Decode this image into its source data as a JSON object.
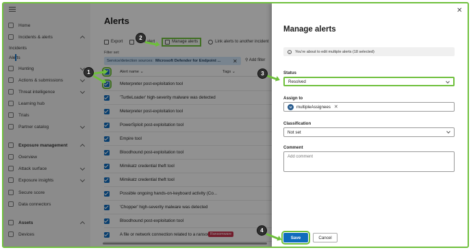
{
  "nav": {
    "items": [
      {
        "label": "Home",
        "icon": "home-icon",
        "chevron": ""
      },
      {
        "label": "Incidents & alerts",
        "icon": "shield-icon",
        "chevron": "up"
      },
      {
        "label": "Incidents",
        "sub": true
      },
      {
        "label": "Alerts",
        "sub": true,
        "active": true
      },
      {
        "label": "Hunting",
        "icon": "hunting-icon",
        "chevron": "down"
      },
      {
        "label": "Actions & submissions",
        "icon": "actions-icon",
        "chevron": "down"
      },
      {
        "label": "Threat intelligence",
        "icon": "intel-icon",
        "chevron": "down"
      },
      {
        "label": "Learning hub",
        "icon": "learning-icon",
        "chevron": ""
      },
      {
        "label": "Trials",
        "icon": "trials-icon",
        "chevron": ""
      },
      {
        "label": "Partner catalog",
        "icon": "catalog-icon",
        "chevron": "down"
      },
      {
        "label": "Exposure management",
        "icon": "exposure-icon",
        "chevron": "up",
        "bold": true
      },
      {
        "label": "Overview",
        "icon": "overview-icon",
        "chevron": ""
      },
      {
        "label": "Attack surface",
        "icon": "attack-icon",
        "chevron": "down"
      },
      {
        "label": "Exposure insights",
        "icon": "insights-icon",
        "chevron": "down"
      },
      {
        "label": "Secure score",
        "icon": "score-icon",
        "chevron": ""
      },
      {
        "label": "Data connectors",
        "icon": "connectors-icon",
        "chevron": ""
      },
      {
        "label": "Assets",
        "icon": "assets-icon",
        "chevron": "up",
        "bold": true
      },
      {
        "label": "Devices",
        "icon": "devices-icon",
        "chevron": ""
      }
    ]
  },
  "main": {
    "title": "Alerts",
    "toolbar": {
      "export": "Export",
      "tune": "Tune alert",
      "manage": "Manage alerts",
      "link": "Link alerts to another incident"
    },
    "filter_label": "Filter set:",
    "filter_chip_key": "Service/detection sources:",
    "filter_chip_value": "Microsoft Defender for Endpoint ...",
    "add_filter": "Add filter",
    "columns": {
      "name": "Alert name",
      "tags": "Tags"
    },
    "rows": [
      {
        "name": "Meterpreter post-exploitation tool",
        "tag": ""
      },
      {
        "name": "'TurtleLoader' high-severity malware was detected",
        "tag": ""
      },
      {
        "name": "Meterpreter post-exploitation tool",
        "tag": ""
      },
      {
        "name": "PowerSploit post-exploitation tool",
        "tag": ""
      },
      {
        "name": "Empire tool",
        "tag": ""
      },
      {
        "name": "Bloodhound post-exploitation tool",
        "tag": ""
      },
      {
        "name": "Mimikatz credential theft tool",
        "tag": ""
      },
      {
        "name": "Mimikatz credential theft tool",
        "tag": ""
      },
      {
        "name": "Possible ongoing hands-on-keyboard activity (Co...",
        "tag": ""
      },
      {
        "name": "'Chopper' high-severity malware was detected",
        "tag": ""
      },
      {
        "name": "Bloodhound post-exploitation tool",
        "tag": ""
      },
      {
        "name": "A file or network connection related to a ransom...",
        "tag": "Ransomware"
      }
    ]
  },
  "panel": {
    "title": "Manage alerts",
    "info": "You're about to edit multiple alerts (18 selected)",
    "status_label": "Status",
    "status_value": "Resolved",
    "assign_label": "Assign to",
    "assignee_initial": "M",
    "assignee": "multipleAssignees",
    "classification_label": "Classification",
    "classification_value": "Not set",
    "comment_label": "Comment",
    "comment_placeholder": "Add comment",
    "save": "Save",
    "cancel": "Cancel"
  },
  "callouts": {
    "one": "1",
    "two": "2",
    "three": "3",
    "four": "4"
  },
  "colors": {
    "accent": "#0f6cbd",
    "highlight": "#6dbf3a",
    "danger": "#c4314b"
  }
}
